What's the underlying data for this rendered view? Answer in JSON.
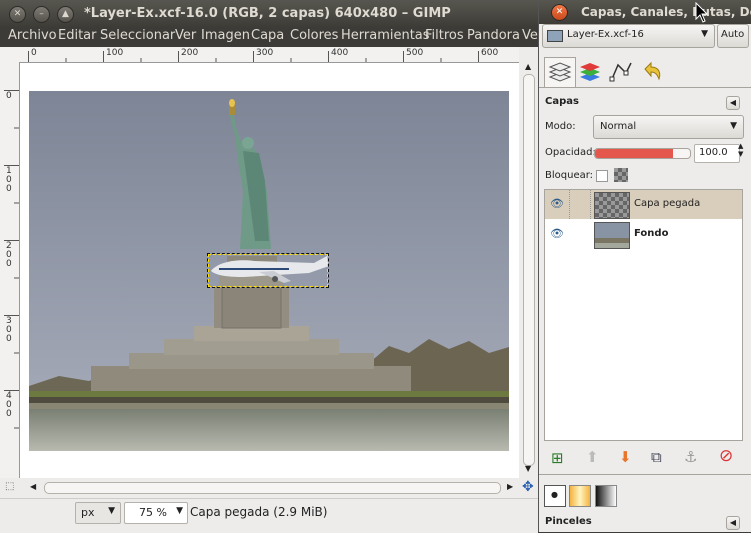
{
  "window": {
    "title": "*Layer-Ex.xcf-16.0 (RGB, 2 capas) 640x480 – GIMP",
    "menu": [
      "Archivo",
      "Editar",
      "Seleccionar",
      "Ver",
      "Imagen",
      "Capa",
      "Colores",
      "Herramientas",
      "Filtros",
      "Pandora",
      "Ver"
    ]
  },
  "rulers": {
    "horizontal": [
      "0",
      "100",
      "200",
      "300",
      "400",
      "500",
      "600"
    ],
    "vertical": [
      "0",
      "100",
      "200",
      "300",
      "400"
    ]
  },
  "status": {
    "unit": "px",
    "zoom": "75 %",
    "message": "Capa pegada (2.9 MiB)"
  },
  "panel": {
    "title": "Capas, Canales, Rutas, De",
    "image_selector": "Layer-Ex.xcf-16",
    "auto_label": "Auto",
    "section_title": "Capas",
    "mode_label": "Modo:",
    "mode_value": "Normal",
    "opacity_label": "Opacidad:",
    "opacity_value": "100.0",
    "opacity_fraction": 1.0,
    "lock_label": "Bloquear:",
    "layers": [
      {
        "name": "Capa pegada",
        "selected": true
      },
      {
        "name": "Fondo",
        "selected": false
      }
    ],
    "brushes_title": "Pinceles"
  },
  "colors": {
    "titlebar": "#3c3b37",
    "selected_row": "#d9cdbb",
    "delete_icon": "#d33"
  }
}
